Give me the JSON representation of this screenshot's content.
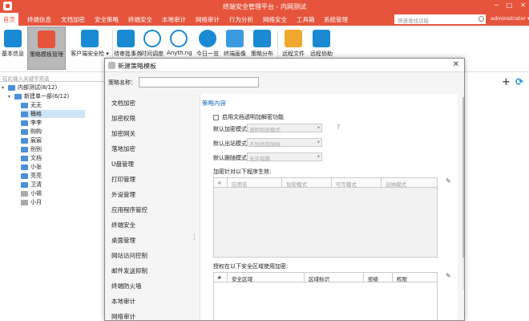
{
  "titlebar": {
    "title": "终端安全管理平台 - 内网测试",
    "minimize": "─",
    "maximize": "□",
    "close": "✕"
  },
  "menu": {
    "items": [
      "首页",
      "终端信息",
      "文档加密",
      "安全策略",
      "终端安全",
      "本地审计",
      "网络审计",
      "行为分析",
      "网络安全",
      "工具箱",
      "系统管理"
    ],
    "search_placeholder": "快速查找功能",
    "user": "administrator ▾"
  },
  "toolbar": {
    "items": [
      {
        "label": "基本信息",
        "icon": "info-card-icon",
        "color": "#1a8ad4"
      },
      {
        "label": "策略模板管理",
        "icon": "policy-template-icon",
        "color": "#e6543c"
      },
      {
        "label": "客户端安全检 ▾",
        "icon": "client-check-icon",
        "color": "#1a8ad4"
      },
      {
        "label": "待审批事务",
        "icon": "approval-icon",
        "color": "#1a8ad4"
      },
      {
        "label": "时间调度",
        "icon": "clock-icon",
        "color": "#1a8ad4"
      },
      {
        "label": "Anyth.ng",
        "icon": "anything-icon",
        "color": "#1a8ad4"
      },
      {
        "label": "今日一览",
        "icon": "eye-icon",
        "color": "#1a8ad4"
      },
      {
        "label": "终端画像",
        "icon": "portrait-icon",
        "color": "#1a8ad4"
      },
      {
        "label": "策略分布",
        "icon": "distribution-icon",
        "color": "#1a8ad4"
      },
      {
        "label": "远程文件",
        "icon": "remote-file-icon",
        "color": "#1a8ad4"
      },
      {
        "label": "远程协助",
        "icon": "remote-assist-icon",
        "color": "#1a8ad4"
      }
    ]
  },
  "left": {
    "search_placeholder": "在此输入关键字筛选",
    "tree": {
      "root": "内部测试(8/12)",
      "group": "新建单一部(6/12)",
      "items": [
        "无无",
        "桶格",
        "李李",
        "购购",
        "宸宸",
        "别别",
        "文档",
        "小张",
        "亮亮",
        "卫清",
        "小锡",
        "小月"
      ],
      "selected_index": 1
    }
  },
  "dialog": {
    "title": "新建策略模板",
    "close": "✕",
    "name_label": "策略名称：",
    "nav": [
      "文档加密",
      "加密权限",
      "加密网关",
      "落地加密",
      "U盘管理",
      "打印管理",
      "外设管理",
      "应用程序管控",
      "终端安全",
      "桌面管理",
      "网站访问控制",
      "邮件发送抑制",
      "终端防火墙",
      "本地审计",
      "网络审计"
    ],
    "section_title": "策略内容",
    "checkbox_label": "启用文档透明加解密功能",
    "selects": [
      {
        "label": "默认加密模式",
        "value": "透明加密模式"
      },
      {
        "label": "默认出站模式",
        "value": "不加密首除候"
      },
      {
        "label": "默认跟随模式",
        "value": "允许指路"
      }
    ],
    "help": "?",
    "table1_label": "加密针对以下程序生效:",
    "table1_headers": [
      "#",
      "应用名",
      "加密模式",
      "可写模式",
      "出纳模式"
    ],
    "table2_label": "授权在以下安全区域使用加密:",
    "table2_headers": [
      "#",
      "安全区域",
      "区域标识",
      "密级",
      "权限"
    ],
    "pencil": "✎"
  },
  "right_icons": {
    "plus": "+",
    "refresh": "⟳"
  }
}
